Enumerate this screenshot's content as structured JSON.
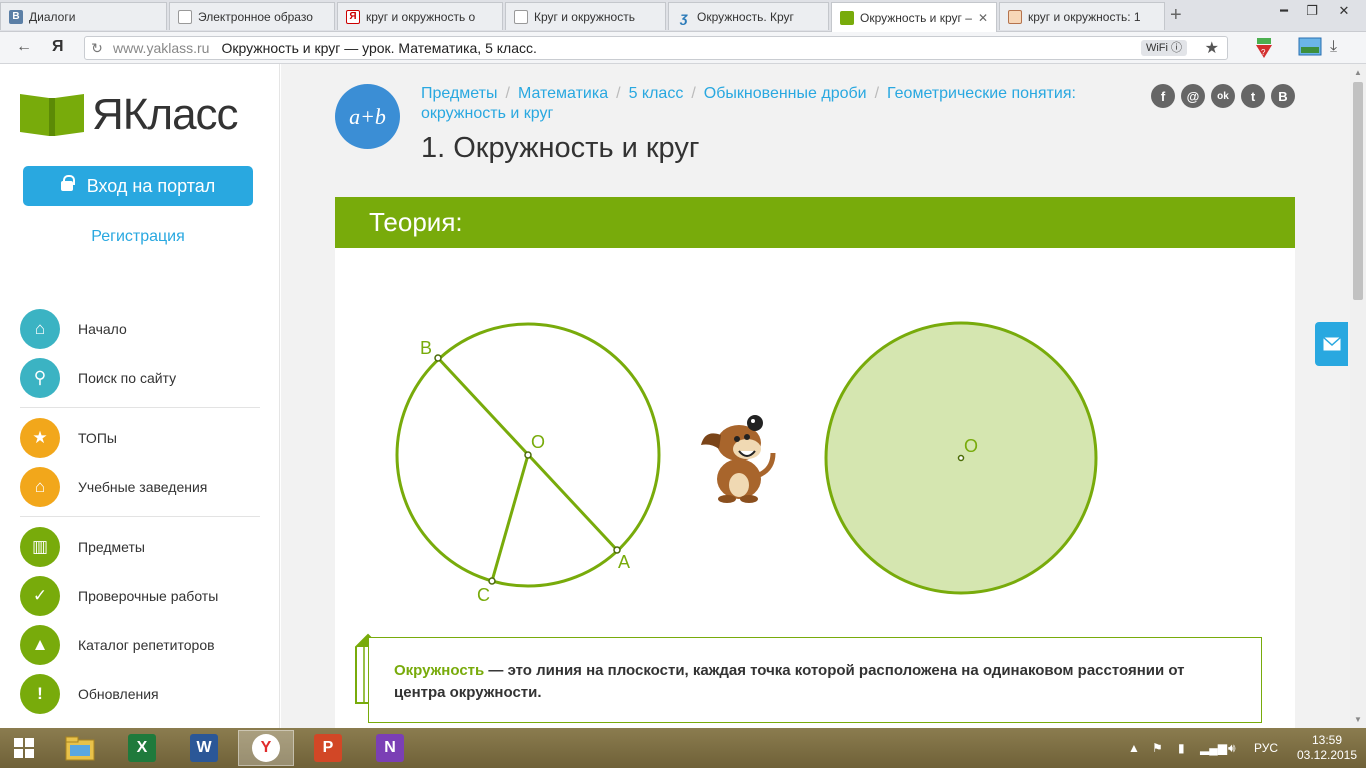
{
  "browser": {
    "tabs": [
      {
        "title": "Диалоги",
        "favicon": "vk-icon",
        "color": "#5b7fa6",
        "glyph": "В"
      },
      {
        "title": "Электронное образо",
        "favicon": "page-icon",
        "color": "#ffffff",
        "glyph": ""
      },
      {
        "title": "круг и окружность о",
        "favicon": "yandex-icon",
        "color": "#ffffff",
        "glyph": "Я"
      },
      {
        "title": "Круг и окружность",
        "favicon": "page-icon",
        "color": "#ffffff",
        "glyph": ""
      },
      {
        "title": "Окружность. Круг",
        "favicon": "script-icon",
        "color": "#ffffff",
        "glyph": "ʒ"
      },
      {
        "title": "Окружность и круг –",
        "favicon": "yaklass-icon",
        "color": "#78ab0b",
        "glyph": ""
      },
      {
        "title": "круг и окружность: 1",
        "favicon": "image-icon",
        "color": "#ffffff",
        "glyph": ""
      }
    ],
    "new_tab": "+",
    "url_host": "www.yaklass.ru",
    "url_title": "Окружность и круг — урок. Математика, 5 класс.",
    "wifi_label": "WiFi"
  },
  "sidebar": {
    "logo_text": "ЯКласс",
    "login_button": "Вход на портал",
    "register_link": "Регистрация",
    "items": [
      {
        "label": "Начало",
        "icon": "home-icon",
        "color": "#3bb3c3",
        "glyph": "⌂"
      },
      {
        "label": "Поиск по сайту",
        "icon": "search-icon",
        "color": "#3bb3c3",
        "glyph": "⚲"
      },
      {
        "label": "ТОПы",
        "icon": "star-icon",
        "color": "#f2a71b",
        "glyph": "★"
      },
      {
        "label": "Учебные заведения",
        "icon": "building-icon",
        "color": "#f2a71b",
        "glyph": "⌂"
      },
      {
        "label": "Предметы",
        "icon": "book-icon",
        "color": "#78ab0b",
        "glyph": "▥"
      },
      {
        "label": "Проверочные работы",
        "icon": "check-icon",
        "color": "#78ab0b",
        "glyph": "✓"
      },
      {
        "label": "Каталог репетиторов",
        "icon": "graduation-cap-icon",
        "color": "#78ab0b",
        "glyph": "▲"
      },
      {
        "label": "Обновления",
        "icon": "exclamation-icon",
        "color": "#78ab0b",
        "glyph": "!"
      }
    ]
  },
  "page": {
    "badge": "a+b",
    "breadcrumbs": [
      "Предметы",
      "Математика",
      "5 класс",
      "Обыкновенные дроби",
      "Геометрические понятия: окружность и круг"
    ],
    "breadcrumb_sep": "/",
    "title": "1. Окружность и круг",
    "social": [
      {
        "icon": "facebook-icon",
        "glyph": "f"
      },
      {
        "icon": "mail-ru-icon",
        "glyph": "@"
      },
      {
        "icon": "odnoklassniki-icon",
        "glyph": "ok"
      },
      {
        "icon": "twitter-icon",
        "glyph": "t"
      },
      {
        "icon": "vk-icon",
        "glyph": "В"
      }
    ],
    "section_title": "Теория:",
    "figure_labels": {
      "B": "B",
      "O": "O",
      "A": "A",
      "C": "C",
      "O2": "O"
    },
    "definition_term": "Окружность",
    "definition_text": " — это линия на плоскости, каждая точка которой расположена на одинаковом расстоянии от центра окружности."
  },
  "colors": {
    "accent_green": "#78ab0b",
    "link_blue": "#29a8e0",
    "fill_green": "#d5e6b0"
  },
  "taskbar": {
    "apps": [
      {
        "name": "file-explorer-icon",
        "color": "#e8c24a",
        "glyph": ""
      },
      {
        "name": "excel-icon",
        "color": "#1f7a3c",
        "glyph": "X"
      },
      {
        "name": "word-icon",
        "color": "#2b5797",
        "glyph": "W"
      },
      {
        "name": "yandex-browser-icon",
        "color": "#ffffff",
        "glyph": "Y"
      },
      {
        "name": "powerpoint-icon",
        "color": "#d24726",
        "glyph": "P"
      },
      {
        "name": "onenote-icon",
        "color": "#7b3fb5",
        "glyph": "N"
      }
    ],
    "language": "РУС",
    "time": "13:59",
    "date": "03.12.2015"
  }
}
